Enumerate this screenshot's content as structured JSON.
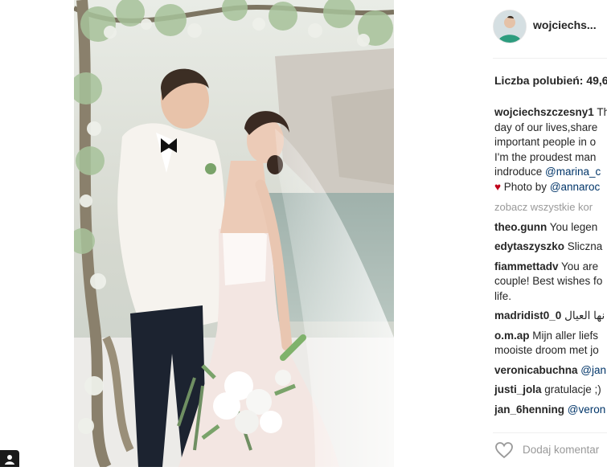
{
  "post": {
    "username": "wojciechs...",
    "likes_label": "Liczba polubień: 49,6",
    "view_all_comments": "zobacz wszystkie kor",
    "add_comment_placeholder": "Dodaj komentar"
  },
  "caption": {
    "user": "wojciechszczesny1",
    "text_1": " Th\nday of our lives,share\nimportant people in o\nI'm the proudest man\nindroduce ",
    "mention_1": "@marina_c",
    "heart": "♥",
    "text_2": " Photo by ",
    "mention_2": "@annaroc"
  },
  "comments": [
    {
      "user": "theo.gunn",
      "text": " You legen"
    },
    {
      "user": "edytaszyszko",
      "text": " Sliczna"
    },
    {
      "user": "fiammettadv",
      "text": " You are\ncouple! Best wishes fo\nlife."
    },
    {
      "user": "madridist0_0",
      "text": " نها العيال"
    },
    {
      "user": "o.m.ap",
      "text": " Mijn aller liefs\nmooiste droom met jo"
    },
    {
      "user": "veronicabuchna",
      "text": " ",
      "mention": "@jan"
    },
    {
      "user": "justi_jola",
      "text": " gratulacje ;)"
    },
    {
      "user": "jan_6henning",
      "text": " ",
      "mention": "@veron"
    }
  ],
  "colors": {
    "mention": "#003569",
    "heart": "#c0001a",
    "muted": "#999999"
  },
  "icons": {
    "like": "heart-outline-icon",
    "corner": "user-tag-icon"
  }
}
